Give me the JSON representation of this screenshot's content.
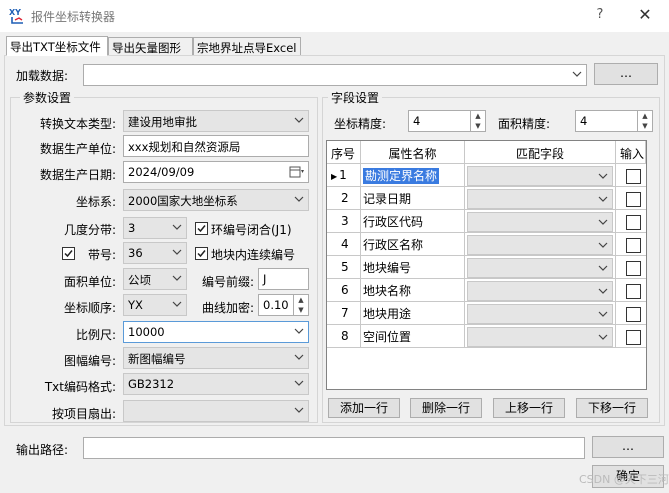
{
  "window": {
    "title": "报件坐标转换器",
    "help_label": "?",
    "close_label": "✕",
    "icon_text": "XY"
  },
  "tabs": [
    "导出TXT坐标文件",
    "导出矢量图形",
    "宗地界址点导Excel"
  ],
  "load": {
    "label": "加载数据:",
    "value": "",
    "browse_label": "…"
  },
  "params": {
    "group_title": "参数设置",
    "text_type": {
      "label": "转换文本类型:",
      "value": "建设用地审批"
    },
    "producer": {
      "label": "数据生产单位:",
      "value": "xxx规划和自然资源局"
    },
    "date": {
      "label": "数据生产日期:",
      "value": "2024/09/09"
    },
    "crs": {
      "label": "坐标系:",
      "value": "2000国家大地坐标系"
    },
    "zone_width": {
      "label": "几度分带:",
      "value": "3"
    },
    "ring_closed": {
      "label": "环编号闭合(J1)",
      "checked": true
    },
    "zone_no": {
      "label": "带号:",
      "value": "36",
      "checked": true
    },
    "continuous_numbering": {
      "label": "地块内连续编号",
      "checked": true
    },
    "area_unit": {
      "label": "面积单位:",
      "value": "公顷"
    },
    "number_prefix": {
      "label": "编号前缀:",
      "value": "J"
    },
    "coord_order": {
      "label": "坐标顺序:",
      "value": "YX"
    },
    "curve_densify": {
      "label": "曲线加密:",
      "value": "0.10"
    },
    "scale": {
      "label": "比例尺:",
      "value": "10000"
    },
    "sheet_no": {
      "label": "图幅编号:",
      "value": "新图幅编号"
    },
    "encoding": {
      "label": "Txt编码格式:",
      "value": "GB2312"
    },
    "by_item": {
      "label": "按项目扇出:",
      "value": ""
    }
  },
  "fields": {
    "group_title": "字段设置",
    "coord_precision": {
      "label": "坐标精度:",
      "value": "4"
    },
    "area_precision": {
      "label": "面积精度:",
      "value": "4"
    },
    "columns": [
      "序号",
      "属性名称",
      "匹配字段",
      "输入"
    ],
    "rows": [
      {
        "no": "1",
        "name": "勘测定界名称"
      },
      {
        "no": "2",
        "name": "记录日期"
      },
      {
        "no": "3",
        "name": "行政区代码"
      },
      {
        "no": "4",
        "name": "行政区名称"
      },
      {
        "no": "5",
        "name": "地块编号"
      },
      {
        "no": "6",
        "name": "地块名称"
      },
      {
        "no": "7",
        "name": "地块用途"
      },
      {
        "no": "8",
        "name": "空间位置"
      }
    ],
    "buttons": [
      "添加一行",
      "删除一行",
      "上移一行",
      "下移一行"
    ]
  },
  "output": {
    "label": "输出路径:",
    "value": "",
    "browse_label": "…"
  },
  "ok_label": "确定",
  "watermark": "CSDN @天下三河",
  "colors": {
    "selection": "#3a7be0",
    "accent_border": "#5a9ad8"
  }
}
